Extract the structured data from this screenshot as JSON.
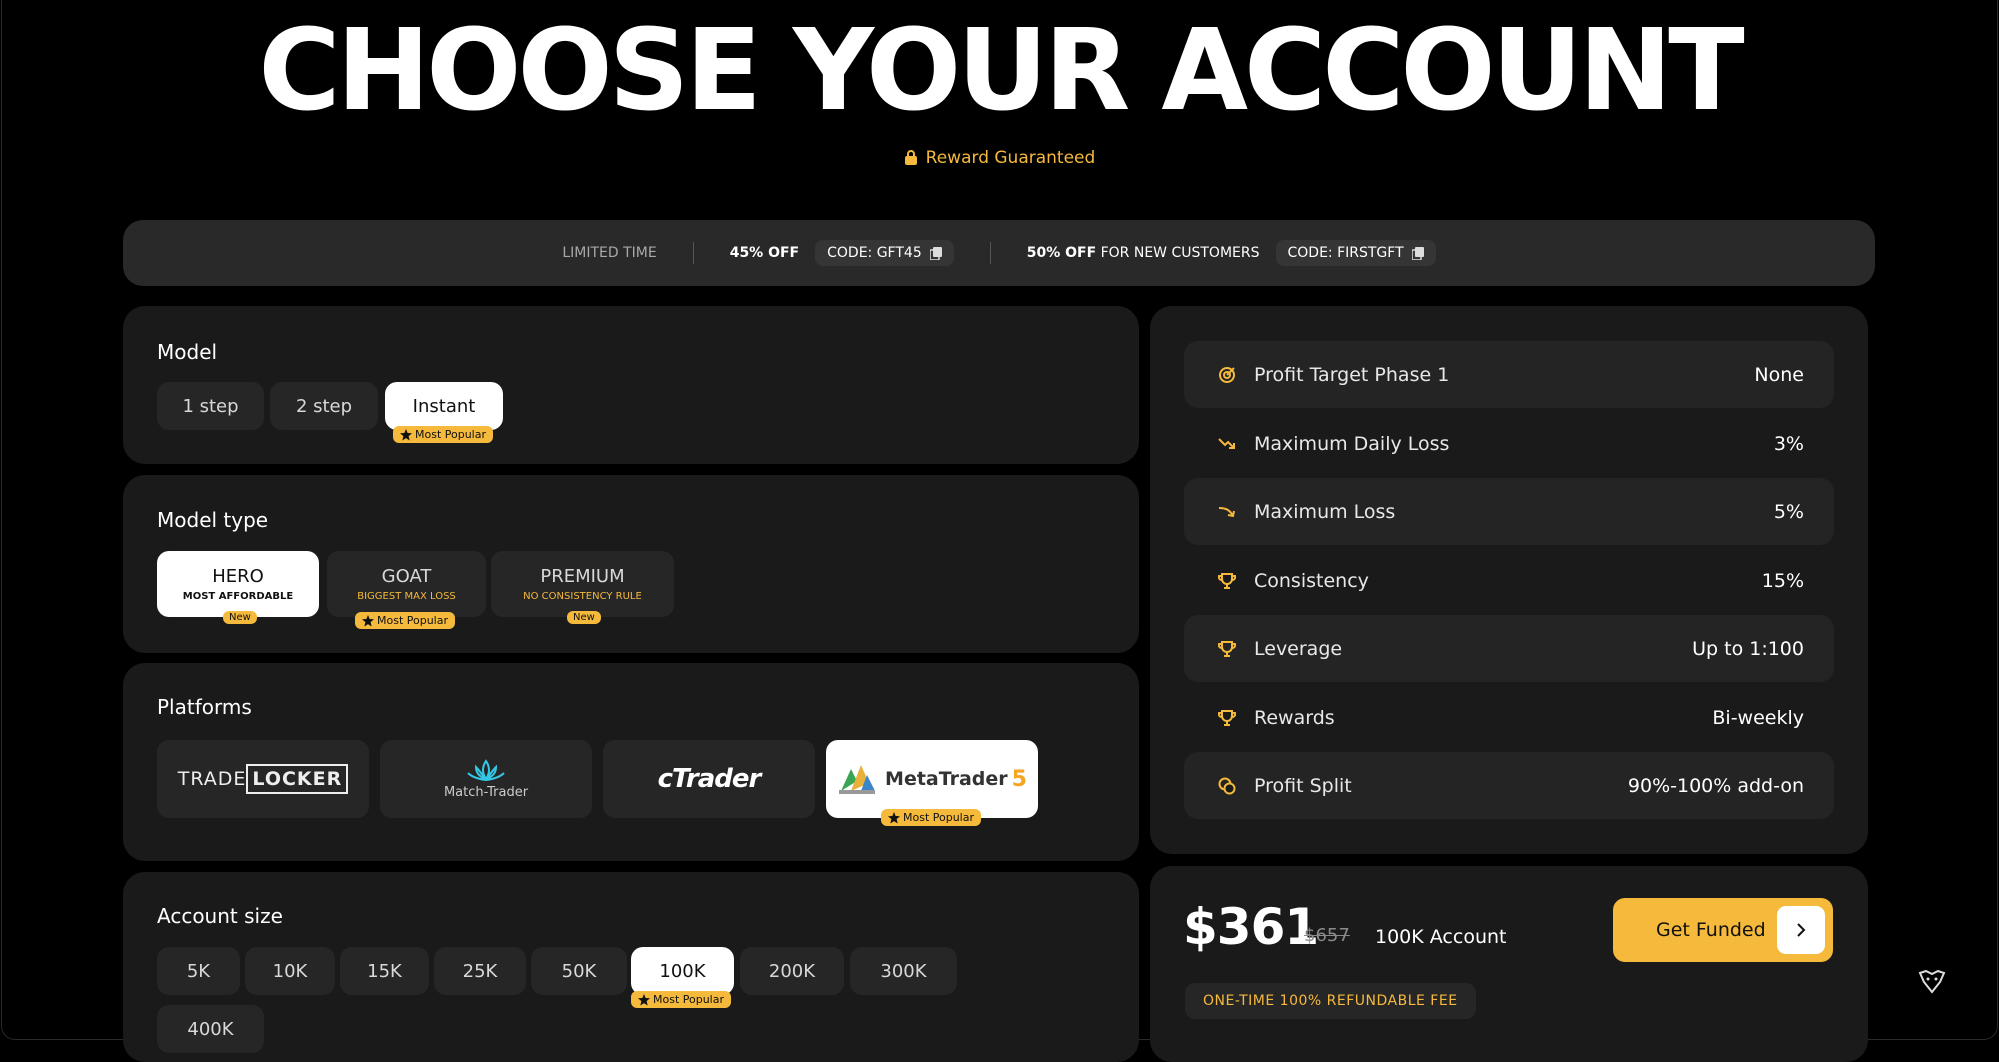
{
  "header": {
    "title": "CHOOSE YOUR ACCOUNT",
    "reward": "Reward Guaranteed"
  },
  "promo": {
    "limited": "LIMITED TIME",
    "offer1_pct": "45% OFF",
    "offer1_code": "CODE: GFT45",
    "offer2_pct": "50% OFF",
    "offer2_text": "FOR NEW CUSTOMERS",
    "offer2_code": "CODE: FIRSTGFT"
  },
  "model": {
    "title": "Model",
    "options": [
      "1 step",
      "2 step",
      "Instant"
    ],
    "selected": "Instant",
    "badge": "Most Popular"
  },
  "model_type": {
    "title": "Model type",
    "options": [
      {
        "name": "HERO",
        "sub": "MOST AFFORDABLE",
        "badge": "New"
      },
      {
        "name": "GOAT",
        "sub": "BIGGEST MAX LOSS",
        "badge": "Most Popular"
      },
      {
        "name": "PREMIUM",
        "sub": "NO CONSISTENCY RULE",
        "badge": "New"
      }
    ],
    "selected": "HERO"
  },
  "platforms": {
    "title": "Platforms",
    "options": [
      "TRADELOCKER",
      "Match-Trader",
      "cTrader",
      "MetaTrader 5"
    ],
    "tradelocker_a": "TRADE",
    "tradelocker_b": "LOCKER",
    "match_trader": "Match-Trader",
    "ctrader": "cTrader",
    "metatrader": "MetaTrader",
    "metatrader_ver": "5",
    "selected": "MetaTrader 5",
    "badge": "Most Popular"
  },
  "account_size": {
    "title": "Account size",
    "options": [
      "5K",
      "10K",
      "15K",
      "25K",
      "50K",
      "100K",
      "200K",
      "300K",
      "400K"
    ],
    "selected": "100K",
    "badge": "Most Popular"
  },
  "rules": [
    {
      "label": "Profit Target Phase 1",
      "value": "None",
      "icon": "target-icon"
    },
    {
      "label": "Maximum Daily Loss",
      "value": "3%",
      "icon": "trend-down-icon"
    },
    {
      "label": "Maximum Loss",
      "value": "5%",
      "icon": "trend-down-icon"
    },
    {
      "label": "Consistency",
      "value": "15%",
      "icon": "trophy-icon"
    },
    {
      "label": "Leverage",
      "value": "Up to 1:100",
      "icon": "trophy-icon"
    },
    {
      "label": "Rewards",
      "value": "Bi-weekly",
      "icon": "trophy-icon"
    },
    {
      "label": "Profit Split",
      "value": "90%-100% add-on",
      "icon": "coins-icon"
    }
  ],
  "checkout": {
    "price": "$361",
    "old_price": "$657",
    "account": "100K Account",
    "fee": "ONE-TIME 100% REFUNDABLE FEE",
    "cta": "Get Funded"
  },
  "colors": {
    "accent": "#f5b93c",
    "card": "#1a1a1a",
    "pill": "#262626"
  }
}
